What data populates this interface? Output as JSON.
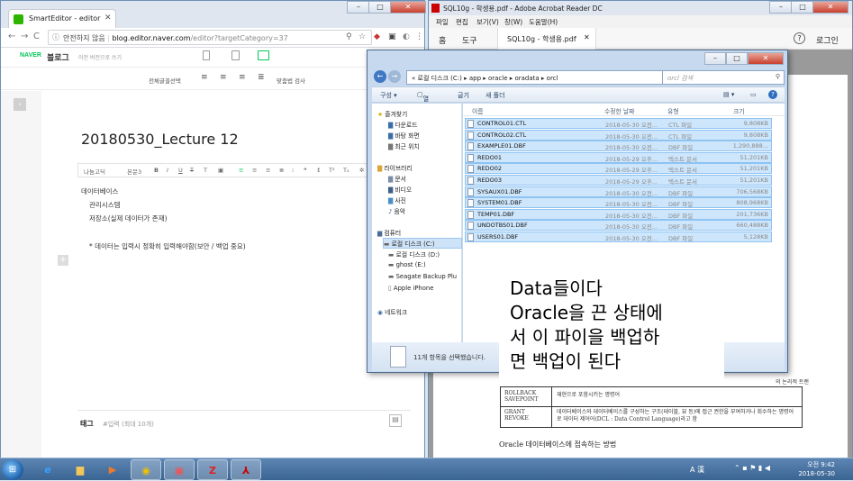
{
  "chrome": {
    "tab_title": "SmartEditor - editor",
    "address_security": "안전하지 않음",
    "address_host": "blog.editor.naver.com",
    "address_path": "/editor?targetCategory=37"
  },
  "editor": {
    "brand": "NAVER",
    "blog": "블로그",
    "prev_version": "이전 버전으로 쓰기",
    "toolbar_select_all": "전체글꼴선택",
    "toolbar_spell": "맞춤법 검사",
    "font_name": "나눔고딕",
    "font_size": "본문3",
    "doc_title": "20180530_Lecture 12",
    "lines": [
      "데이터베이스",
      "관리시스템",
      "저장소(실제 데이터가 존재)",
      "* 데이터는 입력시 정확히 입력해야함(보안 / 백업 중요)"
    ],
    "tag_label": "태그",
    "tag_placeholder": "#입력 (최대 10개)"
  },
  "acrobat": {
    "title": "SQL10g - 학생용.pdf - Adobe Acrobat Reader DC",
    "menu": [
      "파일",
      "편집",
      "보기(V)",
      "창(W)",
      "도움말(H)"
    ],
    "home": "홈",
    "tools": "도구",
    "doc_tab": "SQL10g - 학생용.pdf",
    "login": "로그인",
    "table_rows": [
      {
        "cmd": "ROLLBACK SAVEPOINT",
        "desc": "재현으로 포함시키는 명령어"
      },
      {
        "cmd": "GRANT REVOKE",
        "desc": "데이터베이스와 데이터베이스를 구성하는 구조(테이블, 뷰 등)에 접근 권한을 부여하거나 회수하는 명령어로 데이터 제어어(DCL : Data Control Language)라고 함"
      }
    ],
    "right_fragment": "의 논리적 트랜",
    "heading": "Oracle 데이터베이스에 접속하는 방법"
  },
  "explorer": {
    "path": "« 로컬 디스크 (C:)  ▸  app  ▸  oracle  ▸  oradata  ▸  orcl",
    "search_placeholder": "orcl 검색",
    "commands": [
      "구성 ▾",
      "열기",
      "굽기",
      "새 폴더"
    ],
    "columns": [
      "이름",
      "수정한 날짜",
      "유형",
      "크기"
    ],
    "nav": {
      "favorites": "즐겨찾기",
      "downloads": "다운로드",
      "desktop": "바탕 화면",
      "recent": "최근 위치",
      "libraries": "라이브러리",
      "documents": "문서",
      "videos": "비디오",
      "pictures": "사진",
      "music": "음악",
      "computer": "컴퓨터",
      "drive_c": "로컬 디스크 (C:)",
      "drive_d": "로컬 디스크 (D:)",
      "ghost": "ghost (E:)",
      "seagate": "Seagate Backup Plu",
      "iphone": "Apple iPhone",
      "network": "네트워크"
    },
    "files": [
      {
        "name": "CONTROL01.CTL",
        "date": "2018-05-30 오전...",
        "type": "CTL 파일",
        "size": "9,808KB"
      },
      {
        "name": "CONTROL02.CTL",
        "date": "2018-05-30 오전...",
        "type": "CTL 파일",
        "size": "9,808KB"
      },
      {
        "name": "EXAMPLE01.DBF",
        "date": "2018-05-30 오전...",
        "type": "DBF 파일",
        "size": "1,290,888..."
      },
      {
        "name": "REDO01",
        "date": "2018-05-29 오후...",
        "type": "텍스트 문서",
        "size": "51,201KB"
      },
      {
        "name": "REDO02",
        "date": "2018-05-29 오후...",
        "type": "텍스트 문서",
        "size": "51,201KB"
      },
      {
        "name": "REDO03",
        "date": "2018-05-29 오후...",
        "type": "텍스트 문서",
        "size": "51,201KB"
      },
      {
        "name": "SYSAUX01.DBF",
        "date": "2018-05-30 오전...",
        "type": "DBF 파일",
        "size": "706,568KB"
      },
      {
        "name": "SYSTEM01.DBF",
        "date": "2018-05-30 오전...",
        "type": "DBF 파일",
        "size": "808,968KB"
      },
      {
        "name": "TEMP01.DBF",
        "date": "2018-05-30 오전...",
        "type": "DBF 파일",
        "size": "201,736KB"
      },
      {
        "name": "UNDOTBS01.DBF",
        "date": "2018-05-30 오전...",
        "type": "DBF 파일",
        "size": "660,488KB"
      },
      {
        "name": "USERS01.DBF",
        "date": "2018-05-30 오전...",
        "type": "DBF 파일",
        "size": "5,128KB"
      }
    ],
    "status": "11개 항목을 선택했습니다."
  },
  "note": {
    "lines": [
      "Data들이다",
      "Oracle을 끈 상태에",
      "서 이 파이을 백업하",
      "면 백업이 된다"
    ]
  },
  "taskbar": {
    "lang": "A 漢",
    "time": "오전 9:42",
    "date": "2018-05-30"
  }
}
